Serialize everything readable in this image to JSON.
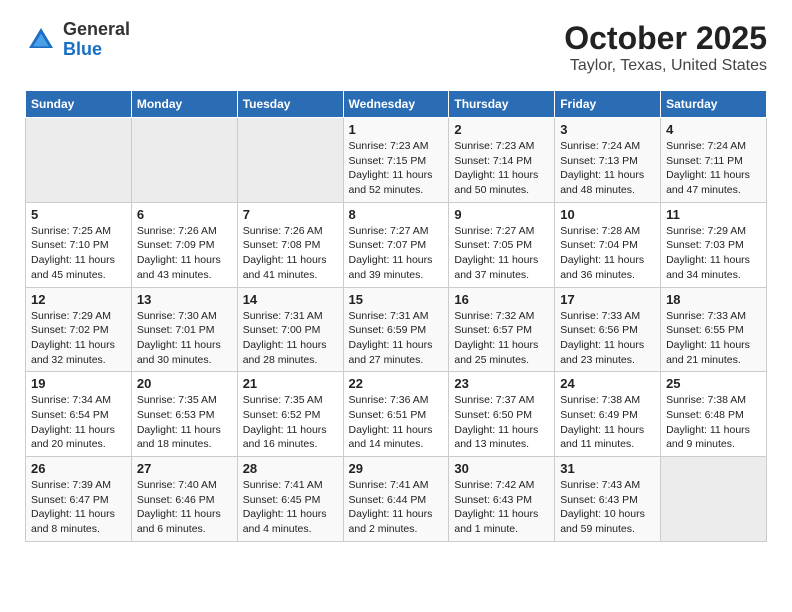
{
  "header": {
    "logo_general": "General",
    "logo_blue": "Blue",
    "title": "October 2025",
    "subtitle": "Taylor, Texas, United States"
  },
  "days_of_week": [
    "Sunday",
    "Monday",
    "Tuesday",
    "Wednesday",
    "Thursday",
    "Friday",
    "Saturday"
  ],
  "weeks": [
    [
      {
        "day": "",
        "info": ""
      },
      {
        "day": "",
        "info": ""
      },
      {
        "day": "",
        "info": ""
      },
      {
        "day": "1",
        "info": "Sunrise: 7:23 AM\nSunset: 7:15 PM\nDaylight: 11 hours\nand 52 minutes."
      },
      {
        "day": "2",
        "info": "Sunrise: 7:23 AM\nSunset: 7:14 PM\nDaylight: 11 hours\nand 50 minutes."
      },
      {
        "day": "3",
        "info": "Sunrise: 7:24 AM\nSunset: 7:13 PM\nDaylight: 11 hours\nand 48 minutes."
      },
      {
        "day": "4",
        "info": "Sunrise: 7:24 AM\nSunset: 7:11 PM\nDaylight: 11 hours\nand 47 minutes."
      }
    ],
    [
      {
        "day": "5",
        "info": "Sunrise: 7:25 AM\nSunset: 7:10 PM\nDaylight: 11 hours\nand 45 minutes."
      },
      {
        "day": "6",
        "info": "Sunrise: 7:26 AM\nSunset: 7:09 PM\nDaylight: 11 hours\nand 43 minutes."
      },
      {
        "day": "7",
        "info": "Sunrise: 7:26 AM\nSunset: 7:08 PM\nDaylight: 11 hours\nand 41 minutes."
      },
      {
        "day": "8",
        "info": "Sunrise: 7:27 AM\nSunset: 7:07 PM\nDaylight: 11 hours\nand 39 minutes."
      },
      {
        "day": "9",
        "info": "Sunrise: 7:27 AM\nSunset: 7:05 PM\nDaylight: 11 hours\nand 37 minutes."
      },
      {
        "day": "10",
        "info": "Sunrise: 7:28 AM\nSunset: 7:04 PM\nDaylight: 11 hours\nand 36 minutes."
      },
      {
        "day": "11",
        "info": "Sunrise: 7:29 AM\nSunset: 7:03 PM\nDaylight: 11 hours\nand 34 minutes."
      }
    ],
    [
      {
        "day": "12",
        "info": "Sunrise: 7:29 AM\nSunset: 7:02 PM\nDaylight: 11 hours\nand 32 minutes."
      },
      {
        "day": "13",
        "info": "Sunrise: 7:30 AM\nSunset: 7:01 PM\nDaylight: 11 hours\nand 30 minutes."
      },
      {
        "day": "14",
        "info": "Sunrise: 7:31 AM\nSunset: 7:00 PM\nDaylight: 11 hours\nand 28 minutes."
      },
      {
        "day": "15",
        "info": "Sunrise: 7:31 AM\nSunset: 6:59 PM\nDaylight: 11 hours\nand 27 minutes."
      },
      {
        "day": "16",
        "info": "Sunrise: 7:32 AM\nSunset: 6:57 PM\nDaylight: 11 hours\nand 25 minutes."
      },
      {
        "day": "17",
        "info": "Sunrise: 7:33 AM\nSunset: 6:56 PM\nDaylight: 11 hours\nand 23 minutes."
      },
      {
        "day": "18",
        "info": "Sunrise: 7:33 AM\nSunset: 6:55 PM\nDaylight: 11 hours\nand 21 minutes."
      }
    ],
    [
      {
        "day": "19",
        "info": "Sunrise: 7:34 AM\nSunset: 6:54 PM\nDaylight: 11 hours\nand 20 minutes."
      },
      {
        "day": "20",
        "info": "Sunrise: 7:35 AM\nSunset: 6:53 PM\nDaylight: 11 hours\nand 18 minutes."
      },
      {
        "day": "21",
        "info": "Sunrise: 7:35 AM\nSunset: 6:52 PM\nDaylight: 11 hours\nand 16 minutes."
      },
      {
        "day": "22",
        "info": "Sunrise: 7:36 AM\nSunset: 6:51 PM\nDaylight: 11 hours\nand 14 minutes."
      },
      {
        "day": "23",
        "info": "Sunrise: 7:37 AM\nSunset: 6:50 PM\nDaylight: 11 hours\nand 13 minutes."
      },
      {
        "day": "24",
        "info": "Sunrise: 7:38 AM\nSunset: 6:49 PM\nDaylight: 11 hours\nand 11 minutes."
      },
      {
        "day": "25",
        "info": "Sunrise: 7:38 AM\nSunset: 6:48 PM\nDaylight: 11 hours\nand 9 minutes."
      }
    ],
    [
      {
        "day": "26",
        "info": "Sunrise: 7:39 AM\nSunset: 6:47 PM\nDaylight: 11 hours\nand 8 minutes."
      },
      {
        "day": "27",
        "info": "Sunrise: 7:40 AM\nSunset: 6:46 PM\nDaylight: 11 hours\nand 6 minutes."
      },
      {
        "day": "28",
        "info": "Sunrise: 7:41 AM\nSunset: 6:45 PM\nDaylight: 11 hours\nand 4 minutes."
      },
      {
        "day": "29",
        "info": "Sunrise: 7:41 AM\nSunset: 6:44 PM\nDaylight: 11 hours\nand 2 minutes."
      },
      {
        "day": "30",
        "info": "Sunrise: 7:42 AM\nSunset: 6:43 PM\nDaylight: 11 hours\nand 1 minute."
      },
      {
        "day": "31",
        "info": "Sunrise: 7:43 AM\nSunset: 6:43 PM\nDaylight: 10 hours\nand 59 minutes."
      },
      {
        "day": "",
        "info": ""
      }
    ]
  ]
}
